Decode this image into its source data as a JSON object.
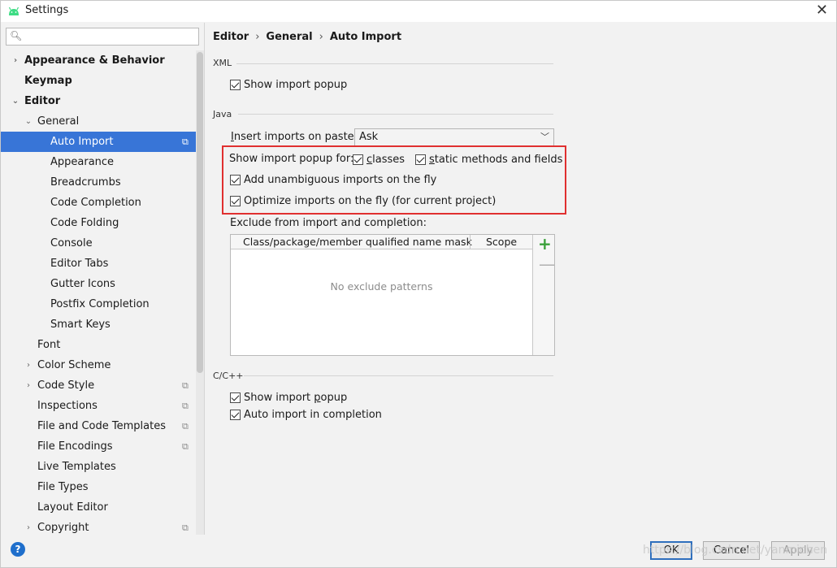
{
  "window": {
    "title": "Settings",
    "close_glyph": "✕",
    "brand_color": "#3ddc84"
  },
  "search": {
    "placeholder": "",
    "value": "",
    "icon": "search-icon"
  },
  "tree": [
    {
      "label": "Appearance & Behavior",
      "arrow": "›",
      "bold": true,
      "level": 0
    },
    {
      "label": "Keymap",
      "arrow": "",
      "bold": true,
      "level": 0
    },
    {
      "label": "Editor",
      "arrow": "⌄",
      "bold": true,
      "level": 0
    },
    {
      "label": "General",
      "arrow": "⌄",
      "bold": false,
      "level": 1
    },
    {
      "label": "Auto Import",
      "arrow": "",
      "bold": false,
      "level": 2,
      "selected": true,
      "project": true
    },
    {
      "label": "Appearance",
      "arrow": "",
      "bold": false,
      "level": 2
    },
    {
      "label": "Breadcrumbs",
      "arrow": "",
      "bold": false,
      "level": 2
    },
    {
      "label": "Code Completion",
      "arrow": "",
      "bold": false,
      "level": 2
    },
    {
      "label": "Code Folding",
      "arrow": "",
      "bold": false,
      "level": 2
    },
    {
      "label": "Console",
      "arrow": "",
      "bold": false,
      "level": 2
    },
    {
      "label": "Editor Tabs",
      "arrow": "",
      "bold": false,
      "level": 2
    },
    {
      "label": "Gutter Icons",
      "arrow": "",
      "bold": false,
      "level": 2
    },
    {
      "label": "Postfix Completion",
      "arrow": "",
      "bold": false,
      "level": 2
    },
    {
      "label": "Smart Keys",
      "arrow": "",
      "bold": false,
      "level": 2
    },
    {
      "label": "Font",
      "arrow": "",
      "bold": false,
      "level": 1
    },
    {
      "label": "Color Scheme",
      "arrow": "›",
      "bold": false,
      "level": 1
    },
    {
      "label": "Code Style",
      "arrow": "›",
      "bold": false,
      "level": 1,
      "project": true
    },
    {
      "label": "Inspections",
      "arrow": "",
      "bold": false,
      "level": 1,
      "project": true
    },
    {
      "label": "File and Code Templates",
      "arrow": "",
      "bold": false,
      "level": 1,
      "project": true
    },
    {
      "label": "File Encodings",
      "arrow": "",
      "bold": false,
      "level": 1,
      "project": true
    },
    {
      "label": "Live Templates",
      "arrow": "",
      "bold": false,
      "level": 1
    },
    {
      "label": "File Types",
      "arrow": "",
      "bold": false,
      "level": 1
    },
    {
      "label": "Layout Editor",
      "arrow": "",
      "bold": false,
      "level": 1
    },
    {
      "label": "Copyright",
      "arrow": "›",
      "bold": false,
      "level": 1,
      "project": true
    }
  ],
  "breadcrumb": {
    "items": [
      "Editor",
      "General",
      "Auto Import"
    ],
    "separator": "›"
  },
  "xml": {
    "title": "XML",
    "show_import_popup": {
      "label": "Show import popup",
      "checked": true
    }
  },
  "java": {
    "title": "Java",
    "insert_imports_label": "Insert imports on paste:",
    "insert_imports_value": "Ask",
    "popup_for_label": "Show import popup for:",
    "classes": {
      "label": "classes",
      "checked": true
    },
    "static_methods": {
      "label": "static methods and fields",
      "checked": true
    },
    "add_unambiguous": {
      "label": "Add unambiguous imports on the fly",
      "checked": true
    },
    "optimize_imports": {
      "label": "Optimize imports on the fly (for current project)",
      "checked": true
    },
    "highlight_color": "#e03030",
    "exclude_label": "Exclude from import and completion:",
    "table": {
      "columns": [
        "Class/package/member qualified name mask",
        "Scope"
      ],
      "empty_text": "No exclude patterns",
      "add_glyph": "+",
      "remove_glyph": "—"
    }
  },
  "cpp": {
    "title": "C/C++",
    "show_import_popup": {
      "label": "Show import popup",
      "checked": true
    },
    "auto_import_completion": {
      "label": "Auto import in completion",
      "checked": true
    }
  },
  "footer": {
    "help_glyph": "?",
    "ok": "OK",
    "cancel": "Cancel",
    "apply": "Apply",
    "watermark": "https://blog.csdn.net/yanmichen"
  },
  "colors": {
    "selection": "#3875d7",
    "add_icon": "#3aa03a",
    "help_icon": "#1f6fcc",
    "ok_border": "#2f6fbd"
  }
}
